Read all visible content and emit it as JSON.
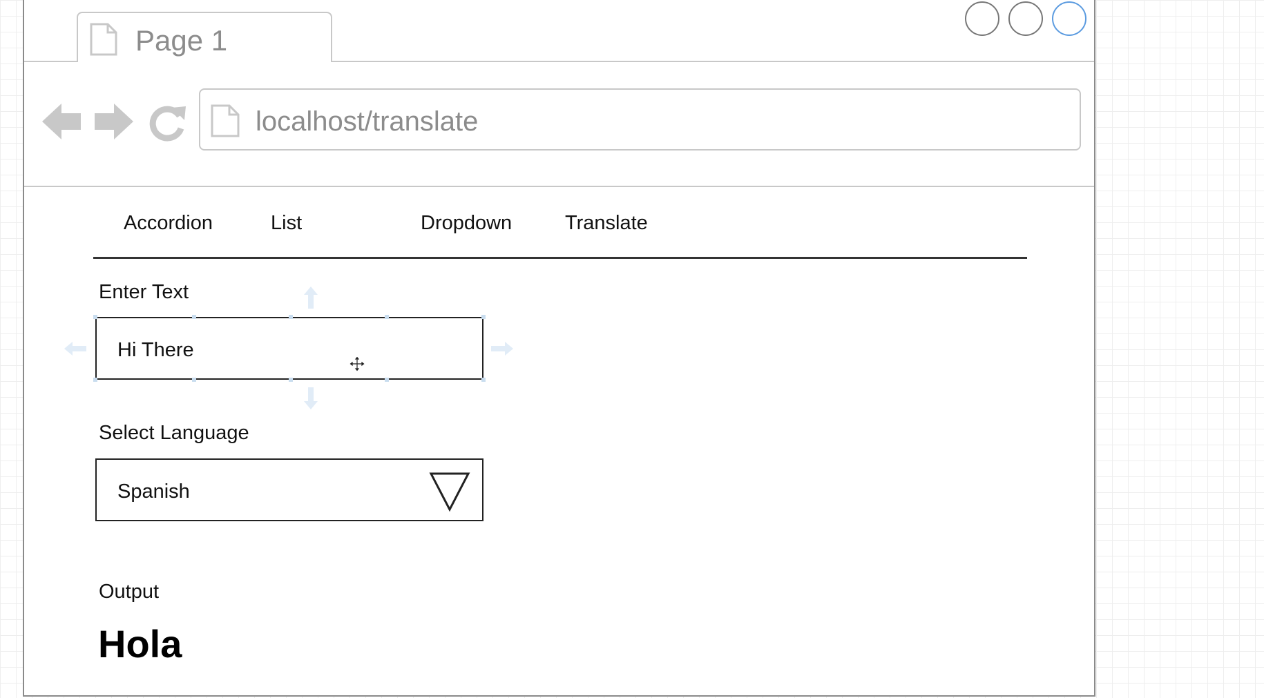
{
  "browser": {
    "tab_title": "Page 1",
    "url": "localhost/translate",
    "icons": {
      "back": "arrow-left-icon",
      "forward": "arrow-right-icon",
      "refresh": "refresh-icon",
      "page": "document-icon"
    },
    "window_buttons": [
      "window-button",
      "window-button",
      "window-button-active"
    ]
  },
  "nav": {
    "items": [
      "Accordion",
      "List",
      "Dropdown",
      "Translate"
    ]
  },
  "form": {
    "enter_text_label": "Enter Text",
    "input_value": "Hi There",
    "select_language_label": "Select Language",
    "selected_language": "Spanish",
    "output_label": "Output",
    "output_value": "Hola"
  },
  "colors": {
    "frame_border": "#8a8a8a",
    "chrome_gray": "#c8c8c8",
    "muted_text": "#8c8c8c",
    "active_blue": "#5b9be0",
    "selection_handle": "#c9ddef"
  }
}
